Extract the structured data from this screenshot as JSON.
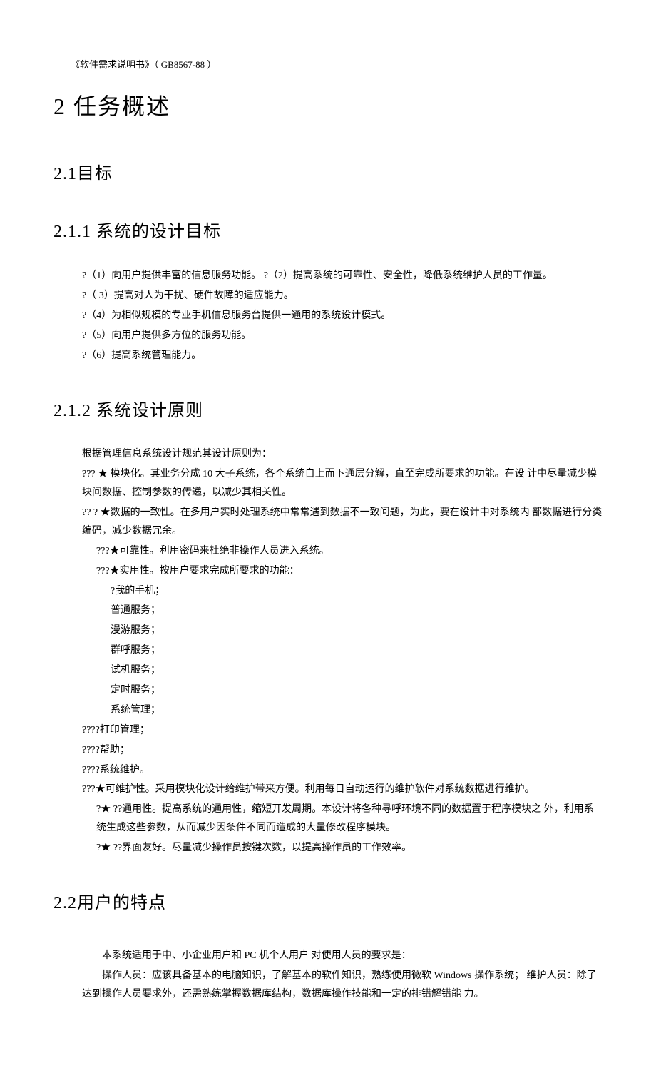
{
  "ref": "《软件需求说明书》（ GB8567-88 ）",
  "h1": "2 任务概述",
  "s21": {
    "title": "2.1目标",
    "s211": {
      "title": "2.1.1 系统的设计目标",
      "lines": [
        "?（1）向用户提供丰富的信息服务功能。 ?（2）提高系统的可靠性、安全性，降低系统维护人员的工作量。",
        "?（ 3）提高对人为干扰、硬件故障的适应能力。",
        "?（4）为相似规模的专业手机信息服务台提供一通用的系统设计模式。",
        "?（5）向用户提供多方位的服务功能。",
        "?（6）提高系统管理能力。"
      ]
    },
    "s212": {
      "title": "2.1.2 系统设计原则",
      "intro": "根据管理信息系统设计规范其设计原则为：",
      "p_module": "??? ★ 模块化。其业务分成 10 大子系统，各个系统自上而下通层分解，直至完成所要求的功能。在设 计中尽量减少模块间数据、控制参数的传递，以减少其相关性。",
      "p_consistency": "?? ? ★数据的一致性。在多用户实时处理系统中常常遇到数据不一致问题，为此，要在设计中对系统内 部数据进行分类编码，减少数据冗余。",
      "p_reliability": "???★可靠性。利用密码来杜绝非操作人员进入系统。",
      "p_practical": "???★实用性。按用户要求完成所要求的功能：",
      "items": [
        "?我的手机；",
        "普通服务；",
        "漫游服务；",
        "群呼服务；",
        "试机服务；",
        "定时服务；",
        "系统管理；"
      ],
      "items2": [
        "????打印管理；",
        "????帮助；",
        "????系统维护。"
      ],
      "p_maintain": "???★可维护性。采用模块化设计给维护带来方便。利用每日自动运行的维护软件对系统数据进行维护。",
      "p_general": "?★ ??通用性。提高系统的通用性，缩短开发周期。本设计将各种寻呼环境不同的数据置于程序模块之 外，利用系统生成这些参数，从而减少因条件不同而造成的大量修改程序模块。",
      "p_ui": "?★ ??界面友好。尽量减少操作员按键次数，以提高操作员的工作效率。"
    }
  },
  "s22": {
    "title": "2.2用户的特点",
    "p1": "本系统适用于中、小企业用户和 PC 机个人用户 对使用人员的要求是：",
    "p2": "操作人员：应该具备基本的电脑知识，了解基本的软件知识，熟练使用微软 Windows 操作系统； 维护人员：除了达到操作人员要求外，还需熟练掌握数据库结构，数据库操作技能和一定的排错解错能 力。"
  }
}
